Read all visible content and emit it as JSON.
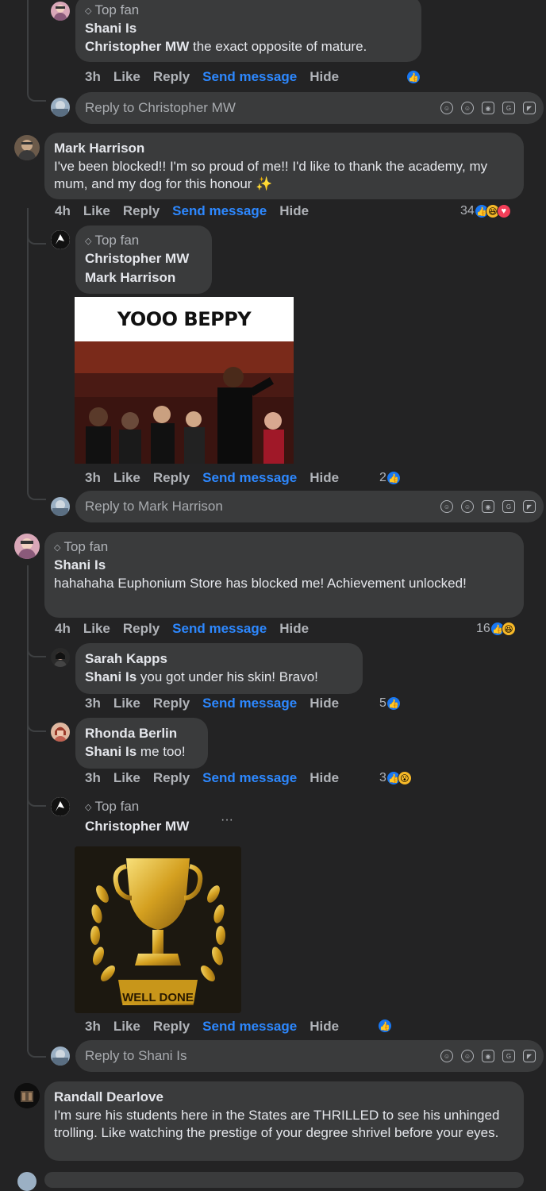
{
  "actions": {
    "like": "Like",
    "reply": "Reply",
    "send": "Send message",
    "hide": "Hide"
  },
  "top_fan_label": "Top fan",
  "c1": {
    "name": "Shani Is",
    "mention": "Christopher MW",
    "text": " the exact opposite of mature.",
    "time": "3h"
  },
  "r1": {
    "placeholder": "Reply to Christopher MW"
  },
  "c2": {
    "name": "Mark Harrison",
    "text": "I've been blocked!! I'm so proud of me!! I'd like to thank the academy, my mum, and my dog for this honour ✨",
    "time": "4h",
    "count": "34"
  },
  "c3": {
    "name": "Christopher MW",
    "mention": "Mark Harrison",
    "gif_caption": "YOOO BEPPY",
    "time": "3h",
    "count": "2"
  },
  "r2": {
    "placeholder": "Reply to Mark Harrison"
  },
  "c4": {
    "name": "Shani Is",
    "text": "hahahaha Euphonium Store has blocked me! Achievement unlocked!",
    "time": "4h",
    "count": "16"
  },
  "c5": {
    "name": "Sarah Kapps",
    "mention": "Shani Is",
    "text": " you got under his skin! Bravo!",
    "time": "3h",
    "count": "5"
  },
  "c6": {
    "name": "Rhonda Berlin",
    "mention": "Shani Is",
    "text": " me too!",
    "time": "3h",
    "count": "3"
  },
  "c7": {
    "name": "Christopher MW",
    "more": "···",
    "image_caption": "WELL DONE",
    "time": "3h"
  },
  "r3": {
    "placeholder": "Reply to Shani Is"
  },
  "c8": {
    "name": "Randall Dearlove",
    "text": "I'm sure his students here in the States are THRILLED to see his unhinged trolling. Like watching the prestige of your degree shrivel before your eyes."
  },
  "colors": {
    "background": "#232324",
    "bubble": "#3a3b3c",
    "link": "#2d88ff",
    "like": "#1877f2"
  }
}
